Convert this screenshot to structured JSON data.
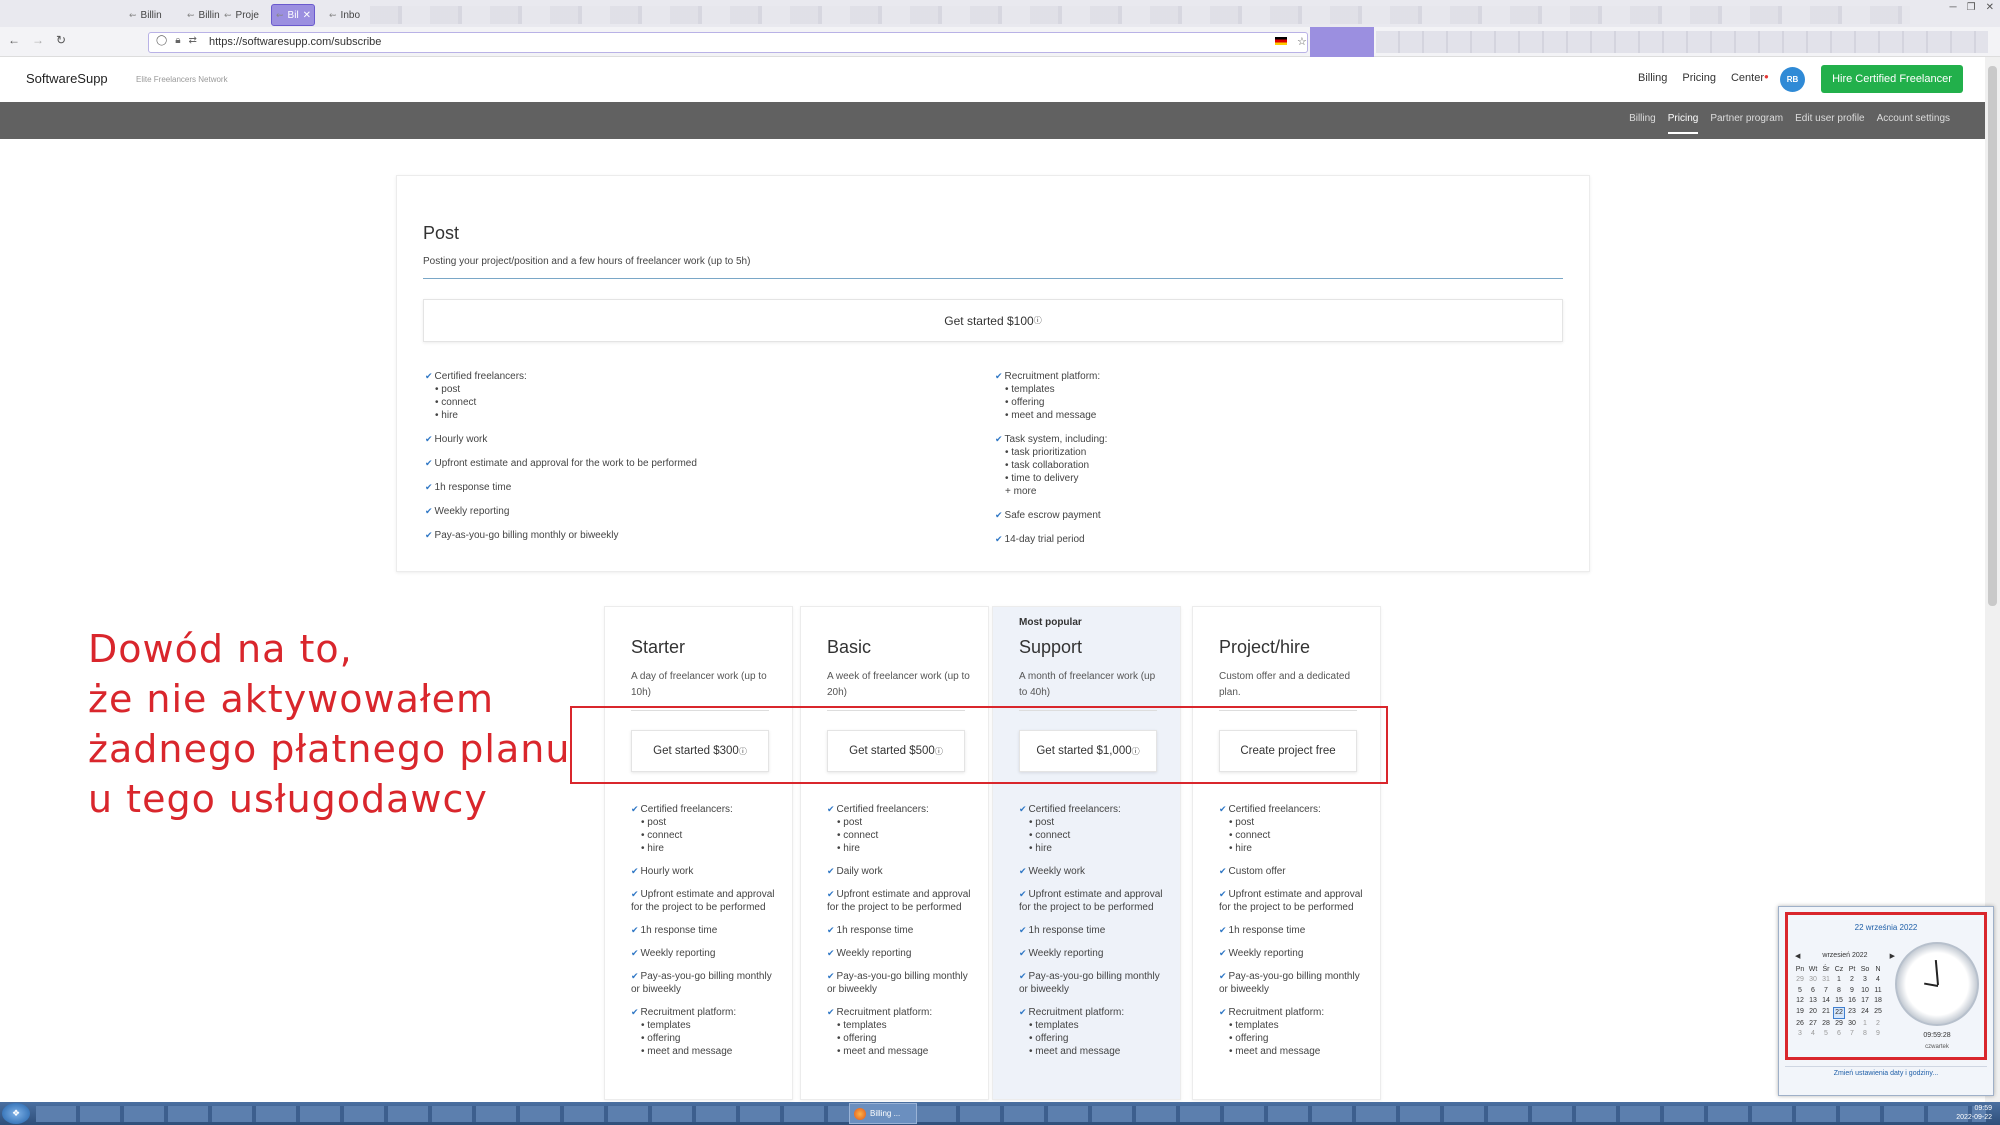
{
  "browser": {
    "tabs": [
      {
        "label": "Billin",
        "active": false
      },
      {
        "label": "Billin",
        "active": false
      },
      {
        "label": "Proje",
        "active": false
      },
      {
        "label": "Bil",
        "active": true
      },
      {
        "label": "Inbo",
        "active": false
      }
    ],
    "url": "https://softwaresupp.com/subscribe"
  },
  "header": {
    "brand": "SoftwareSupp",
    "tagline": "Elite Freelancers Network",
    "nav": [
      "Billing",
      "Pricing",
      "Center"
    ],
    "avatar_initials": "RB",
    "hire_button": "Hire Certified Freelancer"
  },
  "subnav": {
    "items": [
      "Billing",
      "Pricing",
      "Partner program",
      "Edit user profile",
      "Account settings"
    ],
    "active": "Pricing"
  },
  "post_plan": {
    "title": "Post",
    "description": "Posting your project/position and a few hours of freelancer work (up to 5h)",
    "button": "Get started $100",
    "features_left": [
      {
        "label": "Certified freelancers:",
        "sub": [
          "• post",
          "• connect",
          "• hire"
        ]
      },
      {
        "label": "Hourly work",
        "sub": []
      },
      {
        "label": "Upfront estimate and approval for the work to be performed",
        "sub": []
      },
      {
        "label": "1h response time",
        "sub": []
      },
      {
        "label": "Weekly reporting",
        "sub": []
      },
      {
        "label": "Pay-as-you-go billing monthly or biweekly",
        "sub": []
      }
    ],
    "features_right": [
      {
        "label": "Recruitment platform:",
        "sub": [
          "• templates",
          "• offering",
          "• meet and message"
        ]
      },
      {
        "label": "Task system, including:",
        "sub": [
          "• task prioritization",
          "• task collaboration",
          "• time to delivery",
          "+ more"
        ]
      },
      {
        "label": "Safe escrow payment",
        "sub": []
      },
      {
        "label": "14-day trial period",
        "sub": []
      }
    ]
  },
  "plans": [
    {
      "name": "Starter",
      "popular": "",
      "description": "A day of freelancer work (up to 10h)",
      "button": "Get started $300",
      "info": true,
      "features": [
        {
          "label": "Certified freelancers:",
          "sub": [
            "• post",
            "• connect",
            "• hire"
          ]
        },
        {
          "label": "Hourly work",
          "sub": []
        },
        {
          "label": "Upfront estimate and approval for the project to be performed",
          "sub": []
        },
        {
          "label": "1h response time",
          "sub": []
        },
        {
          "label": "Weekly reporting",
          "sub": []
        },
        {
          "label": "Pay-as-you-go billing monthly or biweekly",
          "sub": []
        },
        {
          "label": "Recruitment platform:",
          "sub": [
            "• templates",
            "• offering",
            "• meet and message"
          ]
        }
      ]
    },
    {
      "name": "Basic",
      "popular": "",
      "description": "A week of freelancer work (up to 20h)",
      "button": "Get started $500",
      "info": true,
      "features": [
        {
          "label": "Certified freelancers:",
          "sub": [
            "• post",
            "• connect",
            "• hire"
          ]
        },
        {
          "label": "Daily work",
          "sub": []
        },
        {
          "label": "Upfront estimate and approval for the project to be performed",
          "sub": []
        },
        {
          "label": "1h response time",
          "sub": []
        },
        {
          "label": "Weekly reporting",
          "sub": []
        },
        {
          "label": "Pay-as-you-go billing monthly or biweekly",
          "sub": []
        },
        {
          "label": "Recruitment platform:",
          "sub": [
            "• templates",
            "• offering",
            "• meet and message"
          ]
        }
      ]
    },
    {
      "name": "Support",
      "popular": "Most popular",
      "description": "A month of freelancer work (up to 40h)",
      "button": "Get started $1,000",
      "info": true,
      "features": [
        {
          "label": "Certified freelancers:",
          "sub": [
            "• post",
            "• connect",
            "• hire"
          ]
        },
        {
          "label": "Weekly work",
          "sub": []
        },
        {
          "label": "Upfront estimate and approval for the project to be performed",
          "sub": []
        },
        {
          "label": "1h response time",
          "sub": []
        },
        {
          "label": "Weekly reporting",
          "sub": []
        },
        {
          "label": "Pay-as-you-go billing monthly or biweekly",
          "sub": []
        },
        {
          "label": "Recruitment platform:",
          "sub": [
            "• templates",
            "• offering",
            "• meet and message"
          ]
        }
      ]
    },
    {
      "name": "Project/hire",
      "popular": "",
      "description": "Custom offer and a dedicated plan.",
      "button": "Create project free",
      "info": false,
      "features": [
        {
          "label": "Certified freelancers:",
          "sub": [
            "• post",
            "• connect",
            "• hire"
          ]
        },
        {
          "label": "Custom offer",
          "sub": []
        },
        {
          "label": "Upfront estimate and approval for the project to be performed",
          "sub": []
        },
        {
          "label": "1h response time",
          "sub": []
        },
        {
          "label": "Weekly reporting",
          "sub": []
        },
        {
          "label": "Pay-as-you-go billing monthly or biweekly",
          "sub": []
        },
        {
          "label": "Recruitment platform:",
          "sub": [
            "• templates",
            "• offering",
            "• meet and message"
          ]
        }
      ]
    }
  ],
  "annotation": {
    "lines": [
      "Dowód na to,",
      "że nie aktywowałem",
      "żadnego płatnego planu",
      "u tego usługodawcy"
    ],
    "color": "#d9262c"
  },
  "taskbar": {
    "firefox_label": "Billing ...",
    "time": "09:59",
    "date": "2022-09-22"
  },
  "calendar": {
    "full_date": "22 września 2022",
    "month": "wrzesień 2022",
    "weekdays": [
      "Pn",
      "Wt",
      "Śr",
      "Cz",
      "Pt",
      "So",
      "N"
    ],
    "weeks": [
      [
        "29",
        "30",
        "31",
        "1",
        "2",
        "3",
        "4"
      ],
      [
        "5",
        "6",
        "7",
        "8",
        "9",
        "10",
        "11"
      ],
      [
        "12",
        "13",
        "14",
        "15",
        "16",
        "17",
        "18"
      ],
      [
        "19",
        "20",
        "21",
        "22",
        "23",
        "24",
        "25"
      ],
      [
        "26",
        "27",
        "28",
        "29",
        "30",
        "1",
        "2"
      ],
      [
        "3",
        "4",
        "5",
        "6",
        "7",
        "8",
        "9"
      ]
    ],
    "today": "22",
    "clock_time": "09:59:28",
    "weekday": "czwartek",
    "change_link": "Zmień ustawienia daty i godziny..."
  }
}
